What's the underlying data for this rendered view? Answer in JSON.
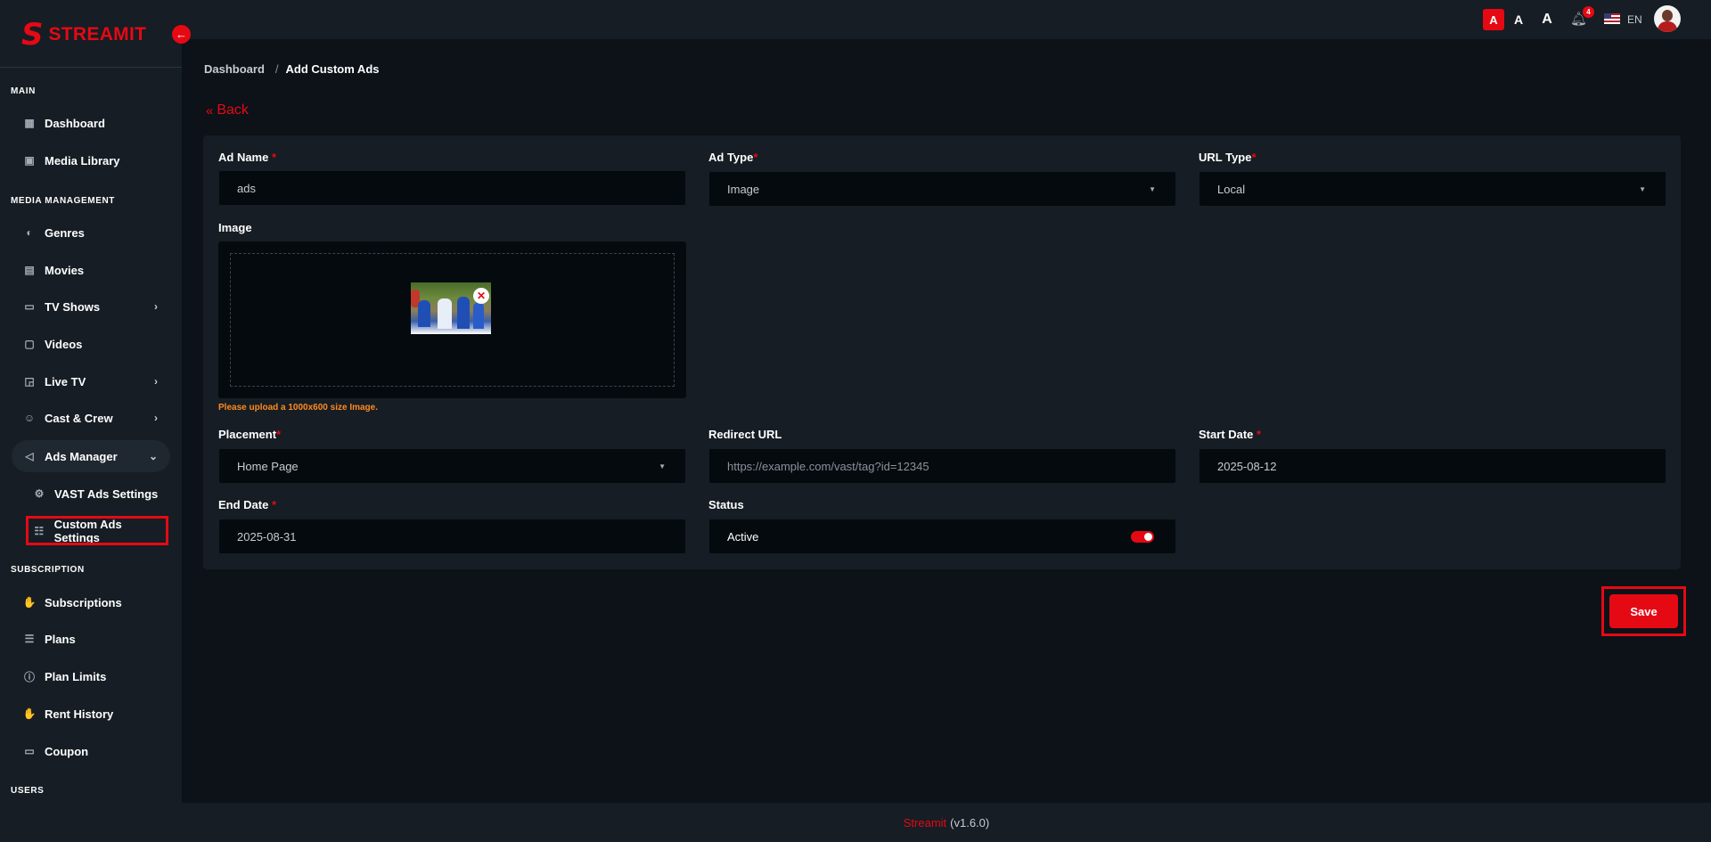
{
  "brand": {
    "logo_letter": "S",
    "name": "STREAMIT"
  },
  "sidebar": {
    "sections": [
      "MAIN",
      "MEDIA MANAGEMENT",
      "SUBSCRIPTION",
      "USERS"
    ],
    "items": [
      {
        "label": "Dashboard",
        "icon": "grid-icon"
      },
      {
        "label": "Media Library",
        "icon": "image-icon"
      },
      {
        "label": "Genres",
        "icon": "mask-icon"
      },
      {
        "label": "Movies",
        "icon": "film-icon"
      },
      {
        "label": "TV Shows",
        "icon": "tv-icon"
      },
      {
        "label": "Videos",
        "icon": "video-icon"
      },
      {
        "label": "Live TV",
        "icon": "cast-icon"
      },
      {
        "label": "Cast & Crew",
        "icon": "users-icon"
      },
      {
        "label": "Ads Manager",
        "icon": "megaphone-icon"
      },
      {
        "label": "VAST Ads Settings",
        "icon": "gear-icon"
      },
      {
        "label": "Custom Ads Settings",
        "icon": "sliders-icon"
      },
      {
        "label": "Subscriptions",
        "icon": "hand-icon"
      },
      {
        "label": "Plans",
        "icon": "list-icon"
      },
      {
        "label": "Plan Limits",
        "icon": "alert-icon"
      },
      {
        "label": "Rent History",
        "icon": "hand-icon"
      },
      {
        "label": "Coupon",
        "icon": "ticket-icon"
      }
    ]
  },
  "topbar": {
    "font_sizes": [
      "A",
      "A",
      "A"
    ],
    "notification_count": "4",
    "language": "EN"
  },
  "breadcrumb": {
    "parent": "Dashboard",
    "separator": "/",
    "current": "Add Custom Ads"
  },
  "back_label": "Back",
  "form": {
    "ad_name": {
      "label": "Ad Name",
      "value": "ads"
    },
    "ad_type": {
      "label": "Ad Type",
      "value": "Image"
    },
    "url_type": {
      "label": "URL Type",
      "value": "Local"
    },
    "image": {
      "label": "Image",
      "hint": "Please upload a 1000x600 size Image."
    },
    "placement": {
      "label": "Placement",
      "value": "Home Page"
    },
    "redirect_url": {
      "label": "Redirect URL",
      "placeholder": "https://example.com/vast/tag?id=12345"
    },
    "start_date": {
      "label": "Start Date",
      "value": "2025-08-12"
    },
    "end_date": {
      "label": "End Date",
      "value": "2025-08-31"
    },
    "status": {
      "label": "Status",
      "value": "Active",
      "enabled": true
    },
    "required_mark": "*"
  },
  "save_label": "Save",
  "footer": {
    "brand": "Streamit",
    "version": "(v1.6.0)"
  },
  "colors": {
    "accent": "#e50914",
    "bg": "#0c1218",
    "panel": "#161d24",
    "input": "#050a0f",
    "hint": "#ff8a1f"
  }
}
